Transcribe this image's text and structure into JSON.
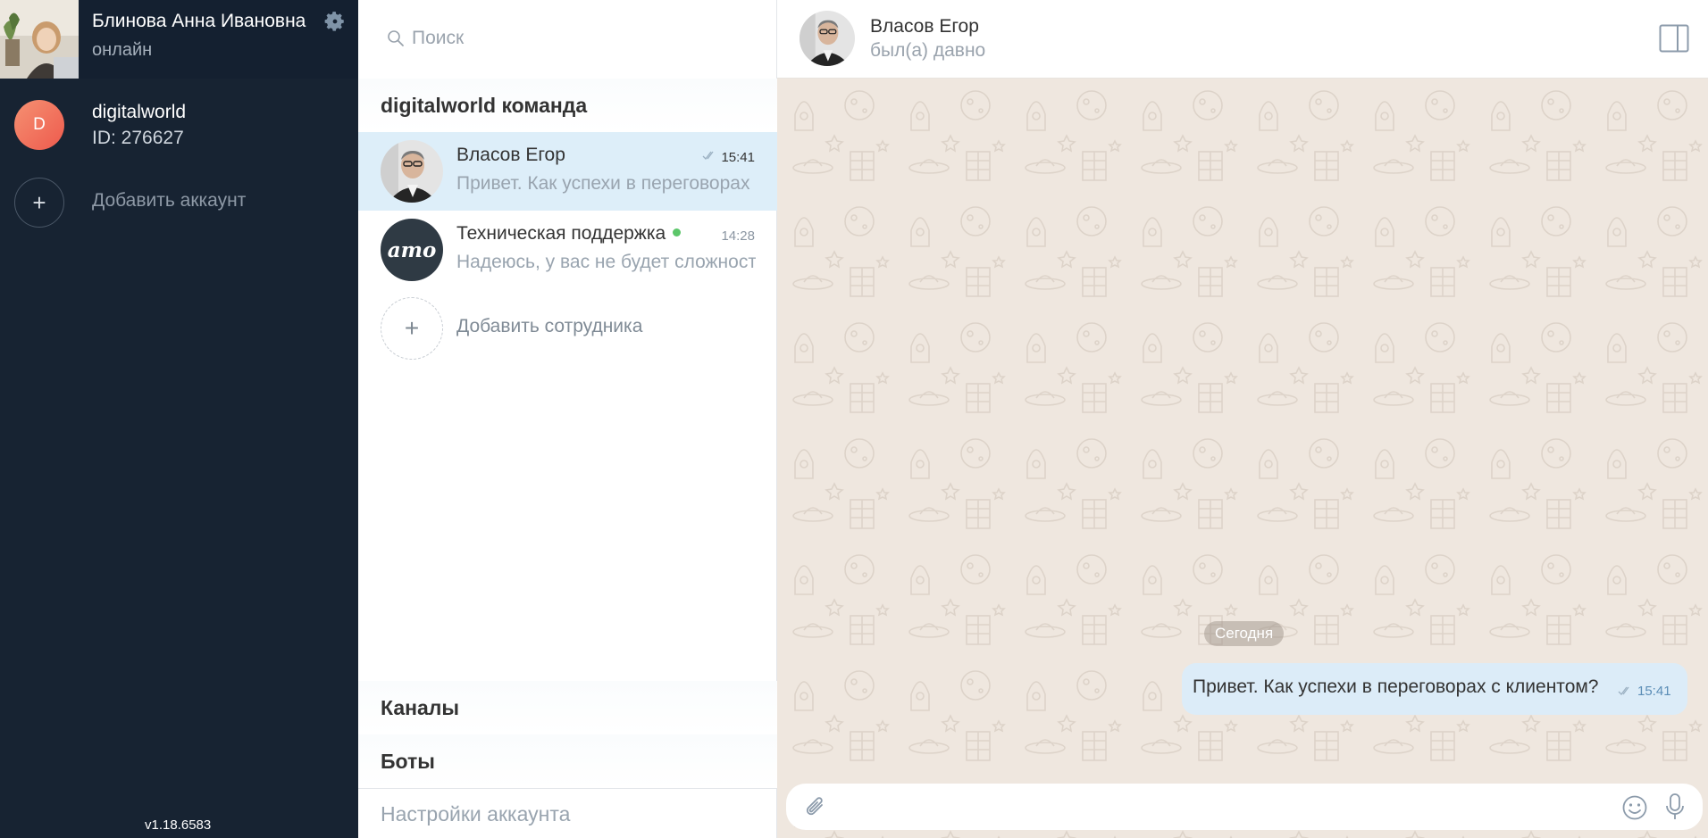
{
  "profile": {
    "name": "Блинова Анна Ивановна",
    "status": "онлайн",
    "settings_icon": "gear-icon"
  },
  "accounts": [
    {
      "initial": "D",
      "name": "digitalworld",
      "id": "ID: 276627"
    }
  ],
  "add_account_label": "Добавить аккаунт",
  "version": "v1.18.6583",
  "search": {
    "placeholder": "Поиск"
  },
  "sections": {
    "team": "digitalworld команда",
    "channels": "Каналы",
    "bots": "Боты"
  },
  "chats": [
    {
      "name": "Власов Егор",
      "time": "15:41",
      "preview": "Привет. Как успехи в переговорах с клиентом?",
      "active": true,
      "read_ticks": true
    },
    {
      "name": "Техническая поддержка",
      "time": "14:28",
      "preview": "Надеюсь, у вас не будет сложностей",
      "online": true,
      "avatar_text": "amo"
    }
  ],
  "add_employee_label": "Добавить сотрудника",
  "account_settings_label": "Настройки аккаунта",
  "conversation": {
    "name": "Власов Егор",
    "status": "был(а) давно",
    "date_badge": "Сегодня",
    "messages": [
      {
        "text": "Привет. Как успехи в переговорах с клиентом?",
        "time": "15:41",
        "outgoing": true
      }
    ],
    "composer_placeholder": ""
  },
  "colors": {
    "sidebar_bg": "#172332",
    "active_chat_bg": "#ddeef9",
    "chat_bg": "#efe7df",
    "bubble_bg": "#dcecf8",
    "online": "#5cc66a",
    "account_avatar": "#f07a5e"
  }
}
